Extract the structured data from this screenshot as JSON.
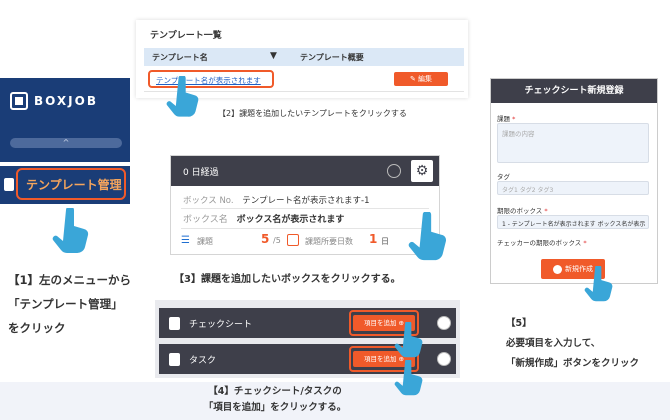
{
  "step1": {
    "logo_text": "BOXJOB",
    "collapse_glyph": "^",
    "menu_label": "テンプレート管理",
    "caption_lines": [
      "【1】左のメニューから",
      "「テンプレート管理」",
      "をクリック"
    ]
  },
  "step2": {
    "title": "テンプレート一覧",
    "col_name": "テンプレート名",
    "sort_arrow": "▼",
    "col_summary": "テンプレート概要",
    "row_link": "テンプレート名が表示されます",
    "edit_label": "編集",
    "caption": "【2】課題を追加したいテンプレートをクリックする"
  },
  "step3": {
    "elapsed": "0 日経過",
    "box_no_label": "ボックス No.",
    "box_no_value": "テンプレート名が表示されます-1",
    "box_name_label": "ボックス名",
    "box_name_value": "ボックス名が表示されます",
    "task_label": "課題",
    "task_count": "5",
    "task_total": "/5",
    "days_label": "課題所要日数",
    "days_value": "1",
    "days_unit": "日",
    "caption": "【3】課題を追加したいボックスをクリックする。"
  },
  "step4": {
    "rows": [
      {
        "label": "チェックシート",
        "button": "項目を追加"
      },
      {
        "label": "タスク",
        "button": "項目を追加"
      }
    ],
    "caption_lines": [
      "【4】チェックシート/タスクの",
      "「項目を追加」をクリックする。"
    ]
  },
  "step5": {
    "title": "チェックシート新規登録",
    "field1_label": "課題",
    "field1_req": "*",
    "field1_placeholder": "課題の内容",
    "field2_label": "タグ",
    "field2_placeholder": "タグ1 タグ2 タグ3",
    "field3_label": "期限のボックス",
    "field3_req": "*",
    "field3_value": "1 - テンプレート名が表示されます ボックス名が表示",
    "field4_label": "チェッカーの期限のボックス",
    "field4_req": "*",
    "button_label": "新規作成",
    "caption_lines": [
      "【5】",
      "必要項目を入力して、",
      "「新規作成」ボタンをクリック"
    ]
  },
  "colors": {
    "accent": "#f05a2a",
    "navy": "#1a3d77",
    "dark_header": "#3e3f4a",
    "hand": "#3aa6d8"
  }
}
